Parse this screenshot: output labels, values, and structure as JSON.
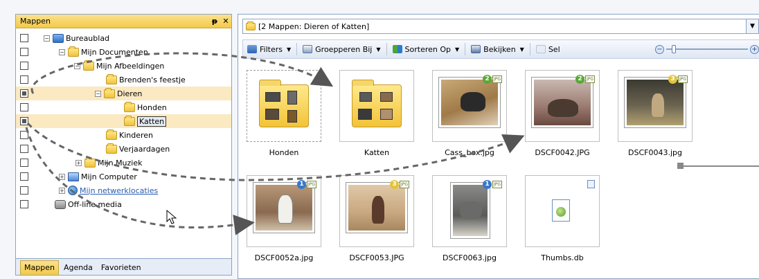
{
  "left_pane": {
    "title": "Mappen",
    "pin_glyph": "📌",
    "close_glyph": "✕",
    "tree": [
      {
        "label": "Bureaublad",
        "icon": "desktop-icon",
        "checked": false
      },
      {
        "label": "Mijn Documenten",
        "icon": "folder-icon",
        "checked": false
      },
      {
        "label": "Mijn Afbeeldingen",
        "icon": "folder-icon",
        "checked": false
      },
      {
        "label": "Brenden's feestje",
        "icon": "folder-icon",
        "checked": false
      },
      {
        "label": "Dieren",
        "icon": "folder-icon",
        "checked": true
      },
      {
        "label": "Honden",
        "icon": "folder-icon",
        "checked": false
      },
      {
        "label": "Katten",
        "icon": "folder-icon",
        "checked": true
      },
      {
        "label": "Kinderen",
        "icon": "folder-icon",
        "checked": false
      },
      {
        "label": "Verjaardagen",
        "icon": "folder-icon",
        "checked": false
      },
      {
        "label": "Mijn Muziek",
        "icon": "folder-icon",
        "checked": false
      },
      {
        "label": "Mijn Computer",
        "icon": "computer-icon",
        "checked": false
      },
      {
        "label": "Mijn netwerklocaties",
        "icon": "network-icon",
        "checked": false
      },
      {
        "label": "Off-line media",
        "icon": "media-icon",
        "checked": false
      }
    ],
    "tabs": [
      "Mappen",
      "Agenda",
      "Favorieten"
    ]
  },
  "address": {
    "text": "[2 Mappen: Dieren of Katten]"
  },
  "toolbar": {
    "filters": "Filters",
    "group": "Groepperen Bij",
    "sort": "Sorteren Op",
    "view": "Bekijken",
    "sel": "Sel",
    "zoom_minus": "−",
    "zoom_plus": "+"
  },
  "items": [
    {
      "name": "Honden",
      "kind": "folder",
      "badge": "",
      "badge_color": ""
    },
    {
      "name": "Katten",
      "kind": "folder",
      "badge": "",
      "badge_color": ""
    },
    {
      "name": "Cass_box.jpg",
      "kind": "photo",
      "badge": "2",
      "badge_color": "green"
    },
    {
      "name": "DSCF0042.JPG",
      "kind": "photo",
      "badge": "2",
      "badge_color": "green"
    },
    {
      "name": "DSCF0043.jpg",
      "kind": "photo",
      "badge": "3",
      "badge_color": "yellow"
    },
    {
      "name": "DSCF0052a.jpg",
      "kind": "photo",
      "badge": "1",
      "badge_color": "blue"
    },
    {
      "name": "DSCF0053.JPG",
      "kind": "photo",
      "badge": "3",
      "badge_color": "yellow"
    },
    {
      "name": "DSCF0063.jpg",
      "kind": "photo",
      "badge": "1",
      "badge_color": "blue"
    },
    {
      "name": "Thumbs.db",
      "kind": "db",
      "badge": "",
      "badge_color": ""
    }
  ],
  "jpg_badge": "JPG",
  "colors": {
    "accent_header": "#f3c947",
    "selection": "#fbe9c2",
    "border": "#8aa3c5"
  }
}
